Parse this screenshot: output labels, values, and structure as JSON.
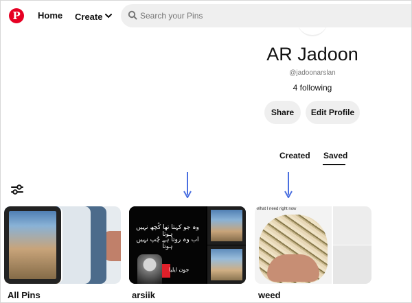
{
  "nav": {
    "logo_glyph": "P",
    "home": "Home",
    "create": "Create",
    "search_placeholder": "Search your Pins"
  },
  "profile": {
    "name": "AR Jadoon",
    "handle": "@jadoonarslan",
    "following": "4 following",
    "share_label": "Share",
    "edit_label": "Edit Profile"
  },
  "tabs": {
    "created": "Created",
    "saved": "Saved",
    "active": "Saved"
  },
  "boards": [
    {
      "title": "All Pins"
    },
    {
      "title": "arsiik",
      "text_lines": [
        "وہ جو کہتا تھا کُچھ نہیں ہوتا",
        "اب وہ روتا ہے چُپ نہیں ہوتا"
      ],
      "signature": "جون ایلیا"
    },
    {
      "title": "weed",
      "caption": "What I need right now"
    }
  ],
  "icons": {
    "logo": "pinterest-logo-icon",
    "create_chevron": "chevron-down-icon",
    "search": "search-icon",
    "filter": "filter-sliders-icon",
    "annotation": "arrow-down-icon"
  },
  "colors": {
    "brand": "#e60023",
    "pill_bg": "#efefef",
    "annotation_arrow": "#4a6fe0"
  }
}
